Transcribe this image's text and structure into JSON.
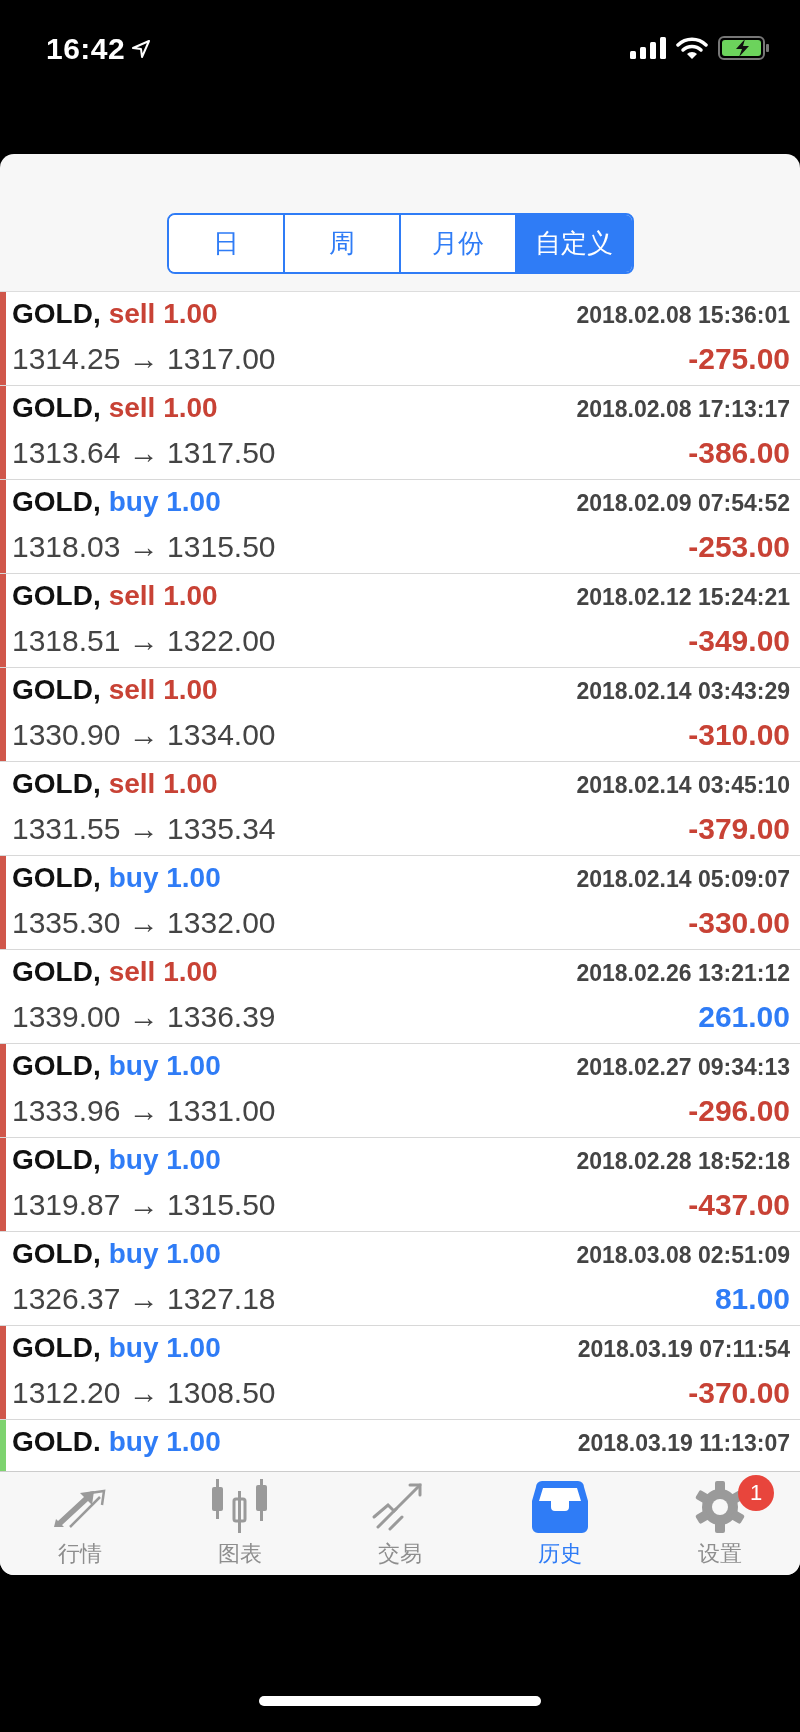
{
  "status_bar": {
    "time": "16:42"
  },
  "segments": [
    {
      "label": "日",
      "selected": false
    },
    {
      "label": "周",
      "selected": false
    },
    {
      "label": "月份",
      "selected": false
    },
    {
      "label": "自定义",
      "selected": true
    }
  ],
  "trades": [
    {
      "symbol": "GOLD,",
      "side": "sell",
      "lots": "1.00",
      "time": "2018.02.08 15:36:01",
      "prices": "1314.25 → 1317.00",
      "profit": "-275.00",
      "loss": true,
      "color": "#d0574b"
    },
    {
      "symbol": "GOLD,",
      "side": "sell",
      "lots": "1.00",
      "time": "2018.02.08 17:13:17",
      "prices": "1313.64 → 1317.50",
      "profit": "-386.00",
      "loss": true,
      "color": "#d0574b"
    },
    {
      "symbol": "GOLD,",
      "side": "buy",
      "lots": "1.00",
      "time": "2018.02.09 07:54:52",
      "prices": "1318.03 → 1315.50",
      "profit": "-253.00",
      "loss": true,
      "color": "#d0574b"
    },
    {
      "symbol": "GOLD,",
      "side": "sell",
      "lots": "1.00",
      "time": "2018.02.12 15:24:21",
      "prices": "1318.51 → 1322.00",
      "profit": "-349.00",
      "loss": true,
      "color": "#d0574b"
    },
    {
      "symbol": "GOLD,",
      "side": "sell",
      "lots": "1.00",
      "time": "2018.02.14 03:43:29",
      "prices": "1330.90 → 1334.00",
      "profit": "-310.00",
      "loss": true,
      "color": "#d0574b"
    },
    {
      "symbol": "GOLD,",
      "side": "sell",
      "lots": "1.00",
      "time": "2018.02.14 03:45:10",
      "prices": "1331.55 → 1335.34",
      "profit": "-379.00",
      "loss": true
    },
    {
      "symbol": "GOLD,",
      "side": "buy",
      "lots": "1.00",
      "time": "2018.02.14 05:09:07",
      "prices": "1335.30 → 1332.00",
      "profit": "-330.00",
      "loss": true,
      "color": "#d0574b"
    },
    {
      "symbol": "GOLD,",
      "side": "sell",
      "lots": "1.00",
      "time": "2018.02.26 13:21:12",
      "prices": "1339.00 → 1336.39",
      "profit": "261.00",
      "loss": false
    },
    {
      "symbol": "GOLD,",
      "side": "buy",
      "lots": "1.00",
      "time": "2018.02.27 09:34:13",
      "prices": "1333.96 → 1331.00",
      "profit": "-296.00",
      "loss": true,
      "color": "#d0574b"
    },
    {
      "symbol": "GOLD,",
      "side": "buy",
      "lots": "1.00",
      "time": "2018.02.28 18:52:18",
      "prices": "1319.87 → 1315.50",
      "profit": "-437.00",
      "loss": true,
      "color": "#d0574b"
    },
    {
      "symbol": "GOLD,",
      "side": "buy",
      "lots": "1.00",
      "time": "2018.03.08 02:51:09",
      "prices": "1326.37 → 1327.18",
      "profit": "81.00",
      "loss": false
    },
    {
      "symbol": "GOLD,",
      "side": "buy",
      "lots": "1.00",
      "time": "2018.03.19 07:11:54",
      "prices": "1312.20 → 1308.50",
      "profit": "-370.00",
      "loss": true,
      "color": "#d0574b"
    },
    {
      "symbol": "GOLD.",
      "side": "buy",
      "lots": "1.00",
      "time": "2018.03.19 11:13:07",
      "color": "#7ed36f"
    }
  ],
  "tab_bar": [
    {
      "kind": "quotes",
      "label": "行情",
      "selected": false
    },
    {
      "kind": "chart",
      "label": "图表",
      "selected": false
    },
    {
      "kind": "trade",
      "label": "交易",
      "selected": false
    },
    {
      "kind": "history",
      "label": "历史",
      "selected": true
    },
    {
      "kind": "settings",
      "label": "设置",
      "selected": false,
      "badge": "1"
    }
  ]
}
